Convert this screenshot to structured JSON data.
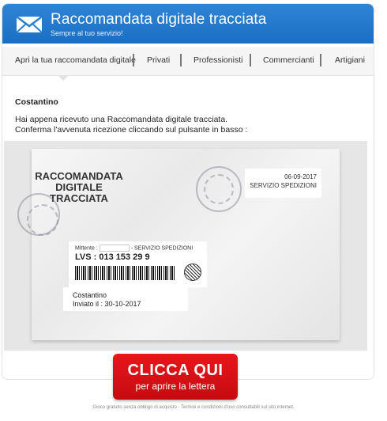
{
  "header": {
    "title": "Raccomandata digitale tracciata",
    "subtitle": "Sempre al tuo servizio!",
    "logo_icon": "envelope-icon",
    "brand_color": "#2a7fd2"
  },
  "nav": {
    "items": [
      {
        "label": "Apri la tua raccomandata digitale"
      },
      {
        "label": "Privati"
      },
      {
        "label": "Professionisti"
      },
      {
        "label": "Commercianti"
      },
      {
        "label": "Artigiani"
      }
    ]
  },
  "message": {
    "greeting": "Costantino",
    "line1": "Hai appena ricevuto una Raccomandata digitale tracciata.",
    "line2": "Conferma l'avvenuta ricezione cliccando sul pulsante in basso :"
  },
  "envelope": {
    "title": "RACCOMANDATA DIGITALE TRACCIATA",
    "date": "06-09-2017",
    "department": "SERVIZIO SPEDIZIONI",
    "mittente_prefix": "Mittente :",
    "mittente_suffix": "- SERVIZIO SPEDIZIONI",
    "tracking": "LVS : 013 153 29 9",
    "recipient_name": "Costantino",
    "sent_date": "Inviato il : 30-10-2017"
  },
  "cta": {
    "main": "CLICCA QUI",
    "sub": "per aprire la lettera",
    "color": "#d8121a"
  },
  "footer": {
    "text": "Gioco gratuito senza obbligo di acquisto - Termini e condizioni d'uso consultabili sul sito internet."
  }
}
